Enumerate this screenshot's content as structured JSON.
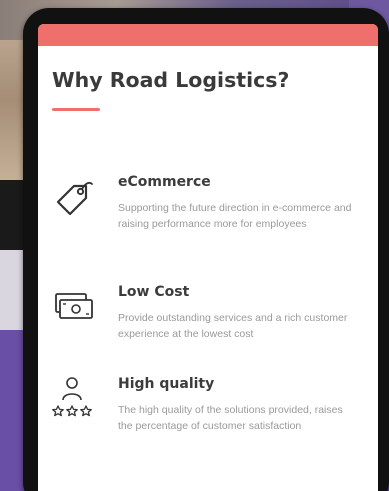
{
  "card": {
    "title": "Why Road Logistics?"
  },
  "features": [
    {
      "icon": "price-tag-icon",
      "title": "eCommerce",
      "description": "Supporting the future direction in e-commerce and raising performance more for employees"
    },
    {
      "icon": "money-bill-icon",
      "title": "Low Cost",
      "description": "Provide outstanding services and a rich customer experience at the lowest cost"
    },
    {
      "icon": "user-rating-stars-icon",
      "title": "High quality",
      "description": "The high quality of the solutions provided, raises the percentage of customer satisfaction"
    }
  ],
  "colors": {
    "accent": "#ee6f6b",
    "title_text": "#3a3a3a",
    "body_text": "#9a9a9a"
  }
}
